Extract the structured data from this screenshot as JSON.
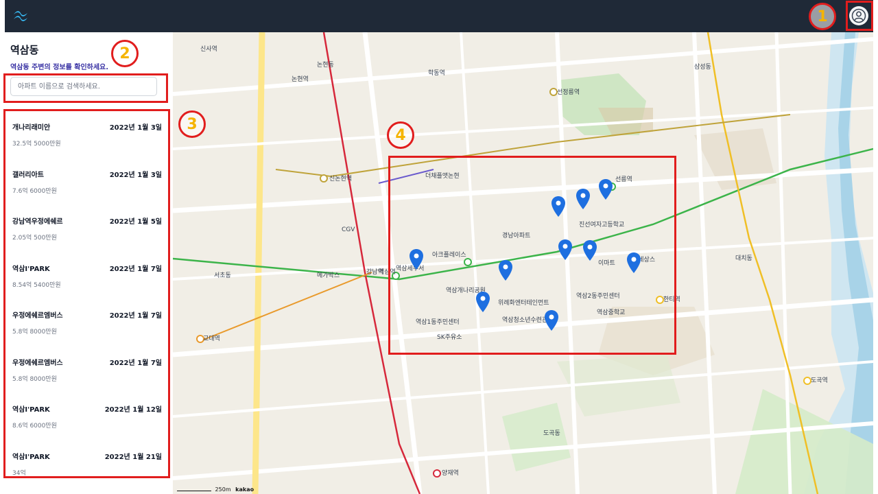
{
  "header": {
    "logo_icon": "tailwind-wave-icon",
    "user_icon": "user-avatar-icon"
  },
  "sidebar": {
    "title": "역삼동",
    "subtitle": "역삼동 주변의 정보를 확인하세요.",
    "search_placeholder": "아파트 이름으로 검색하세요."
  },
  "apartments": [
    {
      "name": "개나리래미안",
      "date": "2022년 1월 3일",
      "price": "32.5억 5000만원"
    },
    {
      "name": "갤러리아트",
      "date": "2022년 1월 3일",
      "price": "7.6억 6000만원"
    },
    {
      "name": "강남역우정에쉐르",
      "date": "2022년 1월 5일",
      "price": "2.05억 500만원"
    },
    {
      "name": "역삼I'PARK",
      "date": "2022년 1월 7일",
      "price": "8.54억 5400만원"
    },
    {
      "name": "우정에쉐르엠버스",
      "date": "2022년 1월 7일",
      "price": "5.8억 8000만원"
    },
    {
      "name": "우정에쉐르엠버스",
      "date": "2022년 1월 7일",
      "price": "5.8억 8000만원"
    },
    {
      "name": "역삼I'PARK",
      "date": "2022년 1월 12일",
      "price": "8.6억 6000만원"
    },
    {
      "name": "역삼I'PARK",
      "date": "2022년 1월 21일",
      "price": "34억"
    }
  ],
  "annotations": {
    "n1": "1",
    "n2": "2",
    "n3": "3",
    "n4": "4"
  },
  "map": {
    "labels": [
      "역삼역",
      "선릉역",
      "강남역",
      "신논현역",
      "논현역",
      "신사역",
      "학동역",
      "선정릉역",
      "한티역",
      "도곡역",
      "양재역",
      "교대역",
      "역삼세무서",
      "더채플앳논현",
      "경남아파트",
      "아크플레이스",
      "역삼개나리공원",
      "위례화엔터테인먼트",
      "역삼1동주민센터",
      "역삼2동주민센터",
      "역삼중학교",
      "진선여자고등학교",
      "대치동",
      "도곡동",
      "SK주유소",
      "메가박스",
      "CGV",
      "이마트",
      "역삼청소년수련관",
      "르네상스",
      "서초동",
      "논현동",
      "삼성동"
    ],
    "scale": "250m",
    "brand": "kakao"
  },
  "colors": {
    "header": "#1f2937",
    "accent_subtitle": "#3730a3",
    "annotation_red": "#e11d1d",
    "annotation_number": "#f5b400",
    "pin_blue": "#1e6fe0"
  }
}
